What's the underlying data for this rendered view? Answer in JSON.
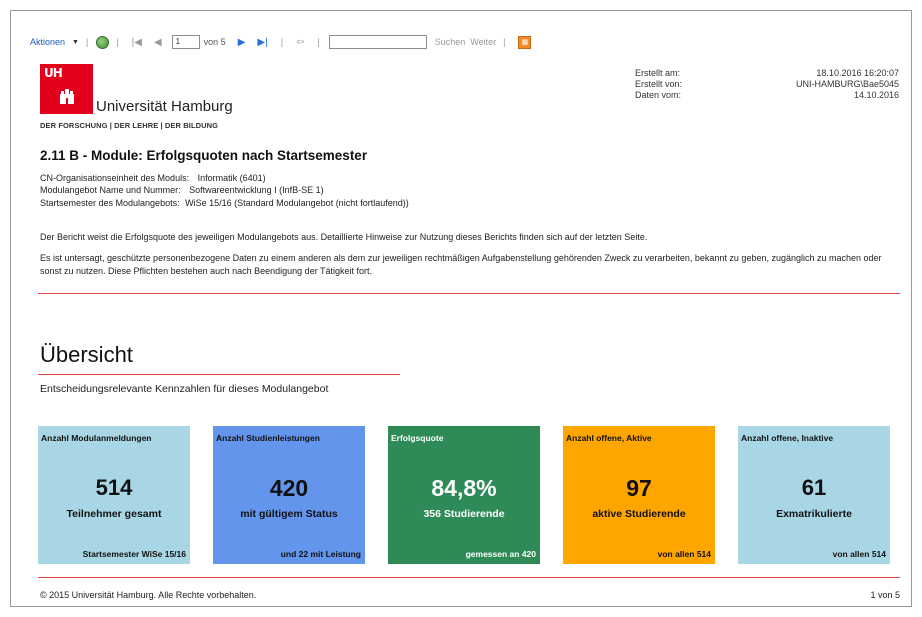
{
  "toolbar": {
    "actions_label": "Aktionen",
    "page_current": "1",
    "page_of": "von 5",
    "search_label": "Suchen",
    "next_label": "Weiter"
  },
  "logo": {
    "abbr": "UH",
    "name": "Universität Hamburg",
    "tagline": "DER FORSCHUNG | DER LEHRE | DER BILDUNG"
  },
  "meta": [
    {
      "label": "Erstellt am:",
      "value": "18.10.2016 16:20:07"
    },
    {
      "label": "Erstellt von:",
      "value": "UNI-HAMBURG\\Bae5045"
    },
    {
      "label": "Daten vom:",
      "value": "14.10.2016"
    }
  ],
  "report": {
    "title": "2.11 B - Module: Erfolgsquoten nach Startsemester",
    "params": [
      {
        "label": "CN-Organisationseinheit des Moduls:",
        "value": "Informatik (6401)"
      },
      {
        "label": "Modulangebot Name und Nummer:",
        "value": "Softwareentwicklung I (InfB-SE 1)"
      },
      {
        "label": "Startsemester des Modulangebots:",
        "value": "WiSe 15/16 (Standard Modulangebot (nicht fortlaufend))"
      }
    ],
    "description": "Der Bericht weist die Erfolgsquote des jeweiligen Modulangebots aus. Detaillierte Hinweise zur Nutzung dieses Berichts finden sich auf der letzten Seite.",
    "notice": "Es ist untersagt, geschützte personenbezogene Daten zu einem anderen als dem zur jeweiligen rechtmäßigen Aufgabenstellung gehörenden Zweck zu verarbeiten, bekannt zu geben, zugänglich zu machen oder sonst zu nutzen. Diese Pflichten bestehen auch nach Beendigung der Tätigkeit fort."
  },
  "overview": {
    "title": "Übersicht",
    "subtitle": "Entscheidungsrelevante Kennzahlen für dieses Modulangebot"
  },
  "tiles": [
    {
      "heading": "Anzahl Modulanmeldungen",
      "value": "514",
      "label": "Teilnehmer gesamt",
      "footer": "Startsemester WiSe 15/16",
      "color": "#a9d6e5"
    },
    {
      "heading": "Anzahl Studienleistungen",
      "value": "420",
      "label": "mit gültigem Status",
      "footer": "und 22 mit Leistung",
      "color": "#6495ed"
    },
    {
      "heading": "Erfolgsquote",
      "value": "84,8%",
      "label": "356 Studierende",
      "footer": "gemessen an 420",
      "color": "#2e8b57"
    },
    {
      "heading": "Anzahl offene, Aktive",
      "value": "97",
      "label": "aktive Studierende",
      "footer": "von allen 514",
      "color": "#ffa500"
    },
    {
      "heading": "Anzahl offene, Inaktive",
      "value": "61",
      "label": "Exmatrikulierte",
      "footer": "von allen 514",
      "color": "#a9d6e5"
    }
  ],
  "footer": {
    "copyright": "© 2015 Universität Hamburg. Alle Rechte vorbehalten.",
    "page": "1 von 5"
  },
  "colors": {
    "accent_red": "#e44a4a",
    "brand_red": "#e2001a",
    "link_blue": "#1a5fb4"
  }
}
